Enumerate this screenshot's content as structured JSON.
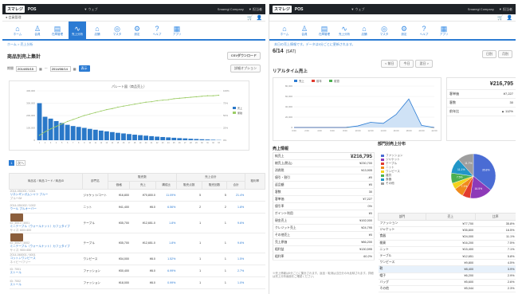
{
  "brand": {
    "logo": "スマレジ",
    "app": "POS",
    "accent": "#2b7bd3",
    "bar_color": "#2a78c8",
    "line_color": "#9ccc65"
  },
  "left": {
    "topbar": {
      "store": "▼ ウェブ",
      "tenant": "Smaregi Company",
      "account": "▼ 担当者",
      "cart_icon": "cart-icon"
    },
    "subnav": "● 会員管理",
    "nav": [
      {
        "label": "ホーム",
        "icon": "home-icon"
      },
      {
        "label": "会員",
        "icon": "member-icon"
      },
      {
        "label": "在庫管理",
        "icon": "stock-icon"
      },
      {
        "label": "売上分析",
        "icon": "chart-icon",
        "active": true
      },
      {
        "label": "店舗",
        "icon": "store-icon"
      },
      {
        "label": "マスタ",
        "icon": "master-icon"
      },
      {
        "label": "設定",
        "icon": "settings-icon"
      },
      {
        "label": "ヘルプ",
        "icon": "help-icon"
      },
      {
        "label": "アプリ",
        "icon": "app-icon"
      }
    ],
    "breadcrumb": "ホーム > 売上分析",
    "title": "商品別売上集計",
    "csv_button": "CSVダウンロード",
    "filter": {
      "label": "期間",
      "from": "2014/05/15",
      "to": "2014/06/14",
      "apply": "表示",
      "options": "詳細オプション"
    },
    "pager": [
      "1",
      "次へ"
    ],
    "table_headers": {
      "name": "商品名 / 商品コード / 商品ID",
      "dept": "部門名",
      "price": "価格",
      "sales_group": "販売数",
      "sales": "売上",
      "ratio": "構成比",
      "qty": "販売点数",
      "count": "販売回数",
      "total_group": "売上合計",
      "total": "合計",
      "avg": "平均",
      "gross": "粗利率",
      "profit": "粗利益"
    },
    "rows": [
      {
        "code": "2014-051001 / 1001",
        "name": "リネンギンガムシャツ ブルー",
        "sub": "ブルー/M",
        "dept": "ジャケット/コート",
        "price": "¥16,800",
        "sales": "¥70,800.0",
        "ratio": "11.09%",
        "qty": "5",
        "count": "5",
        "total": "21.4%",
        "thumb": false
      },
      {
        "code": "2014-051002 / 1002",
        "name": "ウール プルオーバー",
        "sub": "",
        "dept": "ニット",
        "price": "¥41,400",
        "sales": "¥8.0",
        "ratio": "6.56%",
        "qty": "2",
        "count": "2",
        "total": "1.8%",
        "thumb": false
      },
      {
        "code": "ID: 3001 / 3001",
        "name": "ミニテーブル（ウォールナット）カフェタイプ",
        "sub": "サイズ: 600×400",
        "dept": "テーブル",
        "price": "¥35,700",
        "sales": "¥12,651.0",
        "ratio": "1.8%",
        "qty": "1",
        "count": "1",
        "total": "9.6%",
        "thumb": true
      },
      {
        "code": "ID: 3002 / 3002",
        "name": "ミニテーブル（ウォールナット）カフェタイプ",
        "sub": "サイズ: 900×450",
        "dept": "テーブル",
        "price": "¥35,700",
        "sales": "¥12,651.0",
        "ratio": "1.8%",
        "qty": "1",
        "count": "1",
        "total": "9.6%",
        "thumb": true
      },
      {
        "code": "2014-060001 / 6001",
        "name": "コットンワンピース",
        "sub": "ネイビー/フリー",
        "dept": "ワンピース",
        "price": "¥34,000",
        "sales": "¥8.0",
        "ratio": "1.52%",
        "qty": "1",
        "count": "1",
        "total": "1.5%",
        "thumb": false
      },
      {
        "code": "ID: 7001",
        "name": "ストール",
        "sub": "",
        "dept": "ファッション",
        "price": "¥30,400",
        "sales": "¥8.0",
        "ratio": "6.99%",
        "qty": "1",
        "count": "1",
        "total": "2.7%",
        "thumb": false
      },
      {
        "code": "ID: 7002",
        "name": "ストール",
        "sub": "",
        "dept": "ファッション",
        "price": "¥18,000",
        "sales": "¥8.0",
        "ratio": "0.99%",
        "qty": "1",
        "count": "1",
        "total": "1.0%",
        "thumb": false
      }
    ]
  },
  "right": {
    "topbar": {
      "store": "▼ ウェブ",
      "tenant": "Smaregi Company",
      "account": "▼ 担当者"
    },
    "nav": [
      {
        "label": "ホーム",
        "icon": "home-icon"
      },
      {
        "label": "会員",
        "icon": "member-icon"
      },
      {
        "label": "在庫管理",
        "icon": "stock-icon"
      },
      {
        "label": "売上分析",
        "icon": "chart-icon"
      },
      {
        "label": "店舗",
        "icon": "store-icon"
      },
      {
        "label": "マスタ",
        "icon": "master-icon"
      },
      {
        "label": "設定",
        "icon": "settings-icon"
      },
      {
        "label": "ヘルプ",
        "icon": "help-icon"
      },
      {
        "label": "アプリ",
        "icon": "app-icon"
      }
    ],
    "notice": "本日の売上情報です。データは5分ごとに更新されます。",
    "date": "6/14",
    "weekday": "(SAT)",
    "nav_buttons": [
      "< 前日",
      "今日",
      "翌日 >"
    ],
    "view_buttons": [
      "日別",
      "月別"
    ],
    "realtime_title": "リアルタイム売上",
    "summary": {
      "amount": "¥216,795",
      "rows": [
        {
          "k": "客単価",
          "v": "¥7,227"
        },
        {
          "k": "客数",
          "v": "30"
        },
        {
          "k": "前年比",
          "v": "▲ 112%"
        }
      ]
    },
    "sales_info_title": "売上情報",
    "sales_rows": [
      {
        "k": "純売上",
        "v": "¥216,795",
        "big": true
      },
      {
        "k": "総売上(税込)",
        "v": "¥230,700"
      },
      {
        "k": "消費税",
        "v": "¥13,905"
      },
      {
        "k": "値引・割引",
        "v": "-¥0"
      },
      {
        "k": "返品額",
        "v": "¥0"
      },
      {
        "k": "客数",
        "v": "30"
      },
      {
        "k": "客単価",
        "v": "¥7,227"
      },
      {
        "k": "値引率",
        "v": "0%"
      },
      {
        "k": "ポイント利用",
        "v": "¥0"
      },
      {
        "k": "現金売上",
        "v": "¥192,000"
      },
      {
        "k": "クレジット売上",
        "v": "¥24,795"
      },
      {
        "k": "その他売上",
        "v": "¥0"
      },
      {
        "k": "売上原価",
        "v": "¥86,200"
      },
      {
        "k": "粗利益",
        "v": "¥130,595"
      },
      {
        "k": "粗利率",
        "v": "60.2%"
      }
    ],
    "footnote": "※売上情報は5分ごとに集計されます。返品・取消は当日分のみ反映されます。詳細は売上分析画面をご確認ください。",
    "dept_title": "部門別売上分布",
    "dept_legend": [
      "ファッション",
      "ジャケット",
      "テーブル",
      "ニット",
      "ワンピース",
      "雑貨",
      "食器",
      "その他"
    ],
    "dept_table_headers": {
      "dept": "部門",
      "sales": "売上",
      "ratio": "比率"
    },
    "dept_rows": [
      {
        "dept": "ファッション",
        "sales": "¥77,700",
        "ratio": "35.8%"
      },
      {
        "dept": "ジャケット",
        "sales": "¥35,800",
        "ratio": "16.5%"
      },
      {
        "dept": "食器",
        "sales": "¥24,000",
        "ratio": "11.1%"
      },
      {
        "dept": "雑貨",
        "sales": "¥16,200",
        "ratio": "7.5%"
      },
      {
        "dept": "ニット",
        "sales": "¥15,400",
        "ratio": "7.1%"
      },
      {
        "dept": "テーブル",
        "sales": "¥12,651",
        "ratio": "5.8%"
      },
      {
        "dept": "ワンピース",
        "sales": "¥9,800",
        "ratio": "4.5%"
      },
      {
        "dept": "靴",
        "sales": "¥8,400",
        "ratio": "3.9%",
        "hl": true
      },
      {
        "dept": "帽子",
        "sales": "¥6,200",
        "ratio": "2.9%"
      },
      {
        "dept": "バッグ",
        "sales": "¥5,600",
        "ratio": "2.6%"
      },
      {
        "dept": "その他",
        "sales": "¥5,044",
        "ratio": "2.3%"
      }
    ]
  },
  "chart_data": [
    {
      "type": "bar",
      "title": "パレート図（商品売上）",
      "categories": [
        "1",
        "2",
        "3",
        "4",
        "5",
        "6",
        "7",
        "8",
        "9",
        "10",
        "11",
        "12",
        "13",
        "14",
        "15",
        "16",
        "17",
        "18",
        "19",
        "20",
        "21",
        "22",
        "23",
        "24",
        "25",
        "26",
        "27",
        "28",
        "29",
        "30",
        "31",
        "32",
        "33"
      ],
      "series": [
        {
          "name": "売上",
          "values": [
            300000,
            190000,
            175000,
            155000,
            140000,
            125000,
            115000,
            108000,
            100000,
            92000,
            85000,
            78000,
            72000,
            66000,
            60000,
            55000,
            50000,
            45000,
            41000,
            37000,
            33000,
            29000,
            26000,
            23000,
            20000,
            17000,
            15000,
            12000,
            10000,
            8000,
            6000,
            4000,
            2000
          ]
        },
        {
          "name": "累積",
          "values": [
            10,
            17,
            23,
            28,
            33,
            38,
            42,
            46,
            50,
            53,
            56,
            59,
            62,
            64,
            67,
            69,
            71,
            73,
            75,
            77,
            78,
            80,
            81,
            82,
            84,
            85,
            86,
            87,
            88,
            89,
            90,
            90,
            91
          ]
        }
      ],
      "ylim": [
        0,
        400000
      ],
      "y2lim": [
        0,
        100
      ]
    },
    {
      "type": "line",
      "title": "リアルタイム売上",
      "x": [
        "0:00",
        "2:00",
        "4:00",
        "6:00",
        "8:00",
        "10:00",
        "12:00",
        "14:00",
        "16:00",
        "18:00",
        "20:00",
        "22:00"
      ],
      "series": [
        {
          "name": "売上",
          "values": [
            0,
            0,
            0,
            0,
            0,
            3000,
            10000,
            8000,
            25000,
            55000,
            4000,
            0
          ]
        },
        {
          "name": "前年",
          "values": [
            0,
            0,
            0,
            0,
            0,
            2000,
            5000,
            4000,
            9000,
            12000,
            2000,
            0
          ]
        },
        {
          "name": "前週",
          "values": [
            0,
            0,
            0,
            0,
            0,
            1000,
            3000,
            2000,
            6000,
            8000,
            1000,
            0
          ]
        }
      ],
      "ylim": [
        0,
        80000
      ]
    },
    {
      "type": "pie",
      "title": "部門別売上分布",
      "categories": [
        "ファッション",
        "ジャケット",
        "テーブル",
        "ニット",
        "ワンピース",
        "雑貨",
        "食器",
        "その他"
      ],
      "values": [
        35.8,
        16.5,
        5.8,
        7.1,
        4.5,
        7.5,
        11.1,
        11.7
      ],
      "colors": [
        "#4a6cd4",
        "#8e3ab8",
        "#e23b2e",
        "#f08a1c",
        "#f3d21c",
        "#4caf50",
        "#2196c8",
        "#9e9e9e"
      ]
    }
  ]
}
